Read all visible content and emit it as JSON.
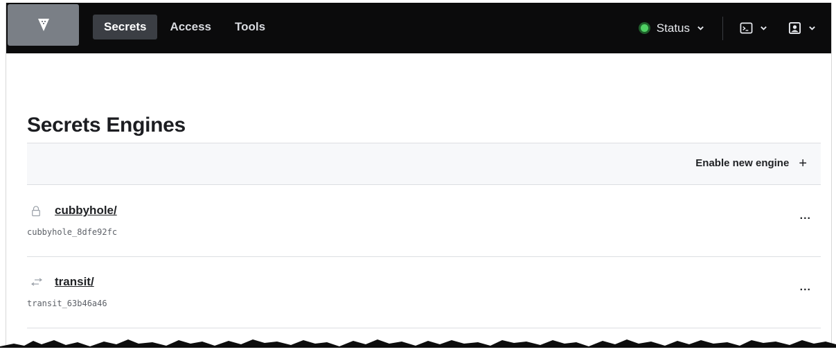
{
  "nav": {
    "links": [
      {
        "label": "Secrets",
        "active": true
      },
      {
        "label": "Access",
        "active": false
      },
      {
        "label": "Tools",
        "active": false
      }
    ],
    "status_label": "Status",
    "status_color": "#4fd164",
    "icons": {
      "logo": "vault-logo-icon",
      "console": "terminal-icon",
      "user": "user-icon",
      "chevron": "chevron-down-icon"
    }
  },
  "page": {
    "title": "Secrets Engines",
    "enable_label": "Enable new engine",
    "enable_icon": "plus-icon"
  },
  "engines": [
    {
      "path": "cubbyhole/",
      "accessor": "cubbyhole_8dfe92fc",
      "icon": "lock-icon",
      "menu_label": "..."
    },
    {
      "path": "transit/",
      "accessor": "transit_63b46a46",
      "icon": "transit-arrows-icon",
      "menu_label": "..."
    }
  ]
}
